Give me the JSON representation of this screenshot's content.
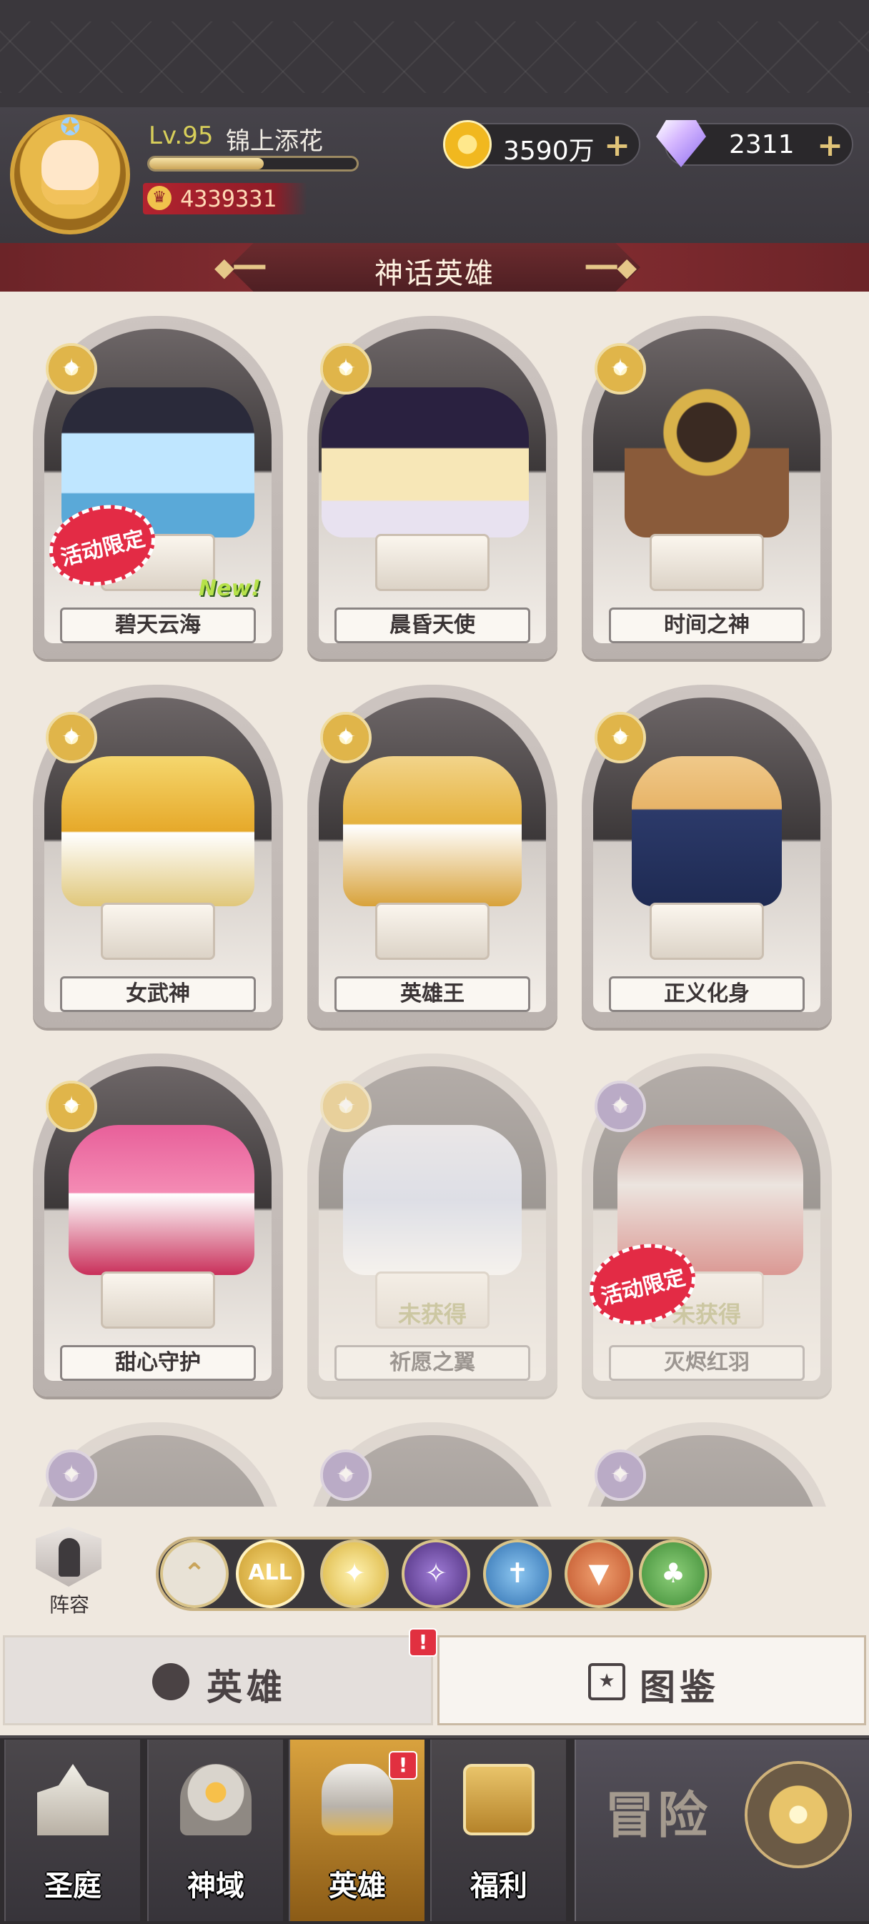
{
  "player": {
    "level": "Lv.95",
    "name": "锦上添花",
    "exp_progress": 0.55,
    "power": "4339331"
  },
  "resources": {
    "gold": "3590万",
    "gems": "2311"
  },
  "section_title": "神话英雄",
  "heroes": [
    {
      "name": "碧天云海",
      "badge": "活动限定",
      "new": "New!",
      "obtained": true
    },
    {
      "name": "晨昏天使",
      "obtained": true
    },
    {
      "name": "时间之神",
      "obtained": true
    },
    {
      "name": "女武神",
      "obtained": true
    },
    {
      "name": "英雄王",
      "obtained": true
    },
    {
      "name": "正义化身",
      "obtained": true
    },
    {
      "name": "甜心守护",
      "obtained": true
    },
    {
      "name": "祈愿之翼",
      "status": "未获得",
      "obtained": false
    },
    {
      "name": "灭烬红羽",
      "status": "未获得",
      "badge": "活动限定",
      "obtained": false
    }
  ],
  "lineup_label": "阵容",
  "filters": {
    "all_label": "ALL",
    "icons": [
      "collapse-up-icon",
      "all",
      "light-faction-icon",
      "dark-faction-icon",
      "holy-faction-icon",
      "fire-faction-icon",
      "nature-faction-icon"
    ],
    "colors": [
      "#e8e2d6",
      "#c99a2b",
      "#d9b23a",
      "#4b2c7a",
      "#2f6fb0",
      "#c0532a",
      "#3d8a35"
    ]
  },
  "tabs": {
    "heroes": "英雄",
    "codex": "图鉴",
    "alert": "!"
  },
  "nav": {
    "court": "圣庭",
    "divine": "神域",
    "heroes": "英雄",
    "welfare": "福利",
    "adventure": "冒险",
    "alert": "!"
  },
  "colors": {
    "accent_gold": "#d9a23e",
    "banner_red": "#8c2f34",
    "limited_badge": "#e32b45"
  }
}
